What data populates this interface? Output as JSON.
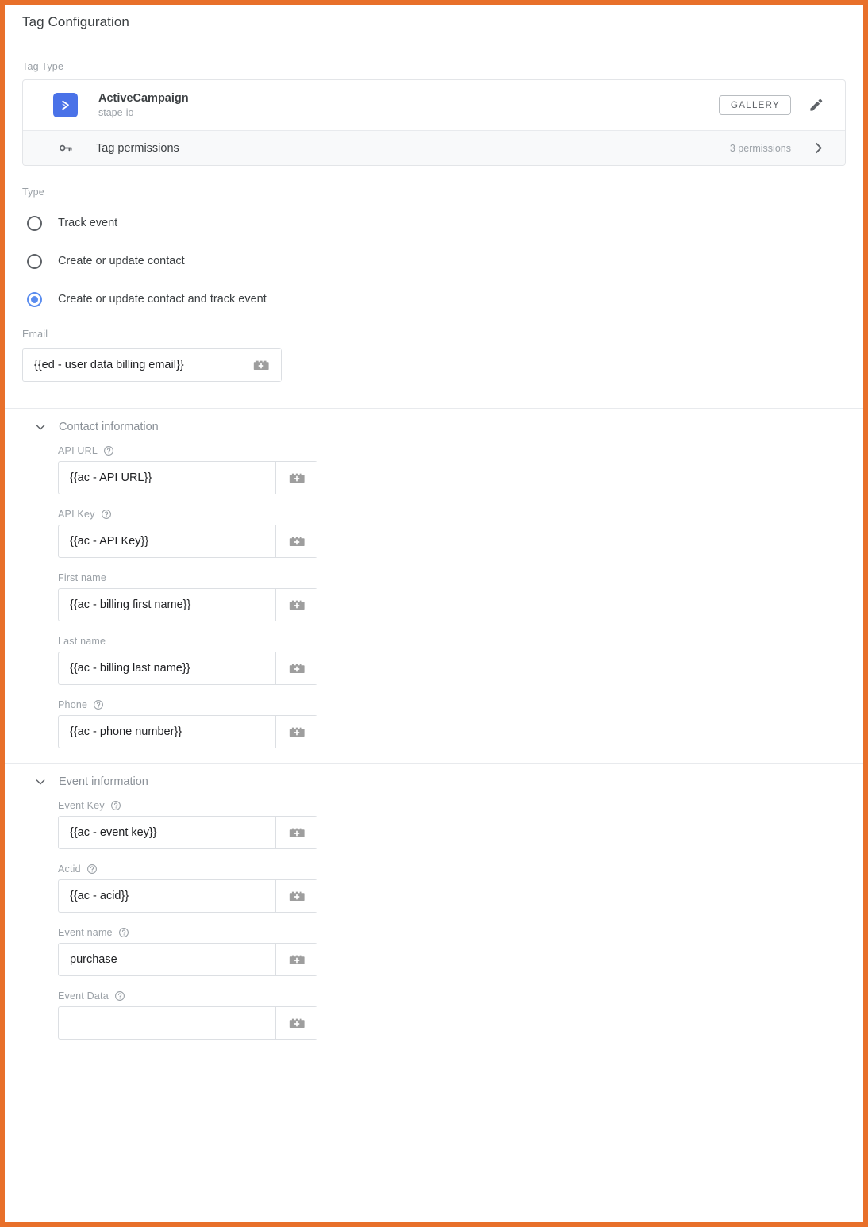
{
  "panel": {
    "title": "Tag Configuration"
  },
  "tag_type": {
    "label": "Tag Type",
    "name": "ActiveCampaign",
    "vendor": "stape-io",
    "gallery_button": "GALLERY",
    "edit_icon": "pencil-icon",
    "logo_icon": "activecampaign-logo-icon",
    "permissions": {
      "icon": "key-icon",
      "label": "Tag permissions",
      "count_text": "3 permissions",
      "arrow_icon": "chevron-right-icon"
    }
  },
  "type_section": {
    "label": "Type",
    "options": [
      {
        "label": "Track event",
        "selected": false
      },
      {
        "label": "Create or update contact",
        "selected": false
      },
      {
        "label": "Create or update contact and track event",
        "selected": true
      }
    ]
  },
  "email_field": {
    "label": "Email",
    "value": "{{ed - user data billing email}}",
    "placeholder": "",
    "variable_icon": "variable-picker-icon"
  },
  "contact_section": {
    "title": "Contact information",
    "chevron_icon": "chevron-down-icon",
    "expanded": true,
    "fields": [
      {
        "label": "API URL",
        "help": true,
        "value": "{{ac - API URL}}"
      },
      {
        "label": "API Key",
        "help": true,
        "value": "{{ac - API Key}}"
      },
      {
        "label": "First name",
        "help": false,
        "value": "{{ac - billing first name}}"
      },
      {
        "label": "Last name",
        "help": false,
        "value": "{{ac - billing last name}}"
      },
      {
        "label": "Phone",
        "help": true,
        "value": "{{ac - phone number}}"
      }
    ]
  },
  "event_section": {
    "title": "Event information",
    "chevron_icon": "chevron-down-icon",
    "expanded": true,
    "fields": [
      {
        "label": "Event Key",
        "help": true,
        "value": "{{ac - event key}}"
      },
      {
        "label": "Actid",
        "help": true,
        "value": "{{ac - acid}}"
      },
      {
        "label": "Event name",
        "help": true,
        "value": "purchase"
      },
      {
        "label": "Event Data",
        "help": true,
        "value": ""
      }
    ]
  },
  "colors": {
    "frame": "#E8702A",
    "brand_blue": "#4A72E8",
    "accent_radio": "#5B8DEF",
    "text_primary": "#3C4043",
    "text_secondary": "#9AA0A6",
    "row_bg": "#F8F9FA"
  }
}
